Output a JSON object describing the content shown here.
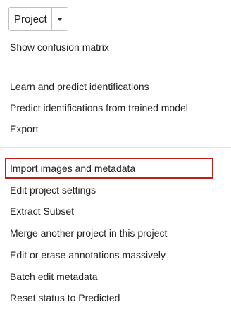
{
  "dropdown": {
    "label": "Project",
    "icon": "caret-down-icon"
  },
  "menu": {
    "show_confusion_matrix": "Show confusion matrix",
    "learn_and_predict": "Learn and predict identifications",
    "predict_from_trained": "Predict identifications from trained model",
    "export": "Export",
    "import_images": "Import images and metadata",
    "edit_project_settings": "Edit project settings",
    "extract_subset": "Extract Subset",
    "merge_project": "Merge another project in this project",
    "edit_erase_annotations": "Edit or erase annotations massively",
    "batch_edit_metadata": "Batch edit metadata",
    "reset_status": "Reset status to Predicted"
  },
  "highlight": {
    "color": "#c0201a",
    "target": "Import images and metadata"
  }
}
